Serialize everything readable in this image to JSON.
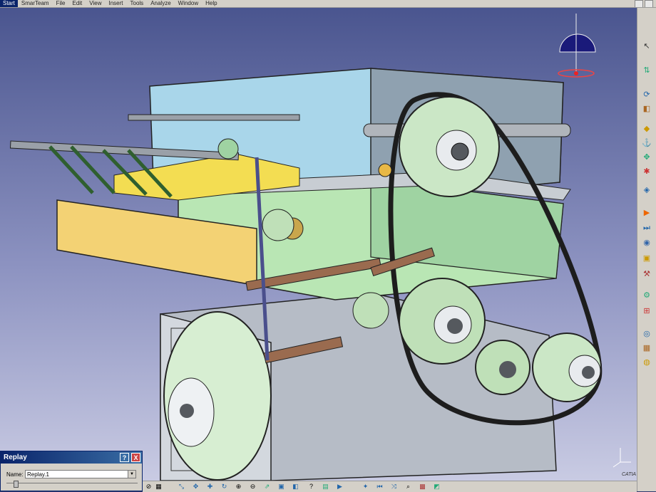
{
  "menu": {
    "start": "Start",
    "items": [
      "SmarTeam",
      "File",
      "Edit",
      "View",
      "Insert",
      "Tools",
      "Analyze",
      "Window",
      "Help"
    ]
  },
  "viewport": {
    "compass_icon": "compass-icon",
    "axis_icon": "xyz-axis-icon",
    "logo_text": "CATIA"
  },
  "right_toolbar": {
    "icons": [
      "select-arrow-icon",
      "fly-icon",
      "rotate-icon",
      "part-icon",
      "constraint-icon",
      "snap-icon",
      "manipulate-icon",
      "explode-icon",
      "clash-icon",
      "sequence-icon",
      "simulation-icon",
      "replay-icon",
      "movie-icon",
      "sensor-icon",
      "tools-icon",
      "measure-icon",
      "color-icon",
      "swap-icon",
      "publish-icon",
      "arrange-icon"
    ]
  },
  "bottom_toolbar": {
    "icons": [
      "sketch-icon",
      "table-icon",
      "fit-all-icon",
      "pan-icon",
      "move-icon",
      "rotate-view-icon",
      "zoom-in-icon",
      "zoom-out-icon",
      "normal-view-icon",
      "iso-view-icon",
      "shading-icon",
      "hide-show-icon",
      "swap-space-icon",
      "help-icon",
      "spatial-icon",
      "film-icon",
      "compass-tool-icon",
      "rewind-icon",
      "step-icon",
      "search-icon",
      "palette-icon",
      "cube-icon"
    ]
  },
  "dialog": {
    "title": "Replay",
    "help_label": "?",
    "close_label": "X",
    "name_label": "Name:",
    "name_value": "Replay.1"
  }
}
